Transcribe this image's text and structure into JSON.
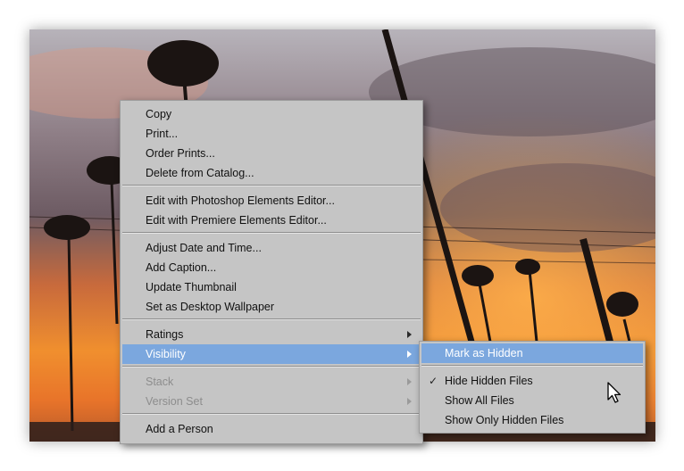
{
  "context_menu": {
    "items": [
      {
        "label": "Copy"
      },
      {
        "label": "Print..."
      },
      {
        "label": "Order Prints..."
      },
      {
        "label": "Delete from Catalog..."
      },
      {
        "label": "Edit with Photoshop Elements Editor..."
      },
      {
        "label": "Edit with Premiere Elements Editor..."
      },
      {
        "label": "Adjust Date and Time..."
      },
      {
        "label": "Add Caption..."
      },
      {
        "label": "Update Thumbnail"
      },
      {
        "label": "Set as Desktop Wallpaper"
      },
      {
        "label": "Ratings"
      },
      {
        "label": "Visibility"
      },
      {
        "label": "Stack"
      },
      {
        "label": "Version Set"
      },
      {
        "label": "Add a Person"
      }
    ]
  },
  "visibility_submenu": {
    "items": [
      {
        "label": "Mark as Hidden"
      },
      {
        "label": "Hide Hidden Files",
        "checked": true
      },
      {
        "label": "Show All Files"
      },
      {
        "label": "Show Only Hidden Files"
      }
    ],
    "check_glyph": "✓"
  },
  "colors": {
    "menu_background": "#c5c5c5",
    "highlight": "#7ba7de",
    "disabled_text": "#8d8d8d"
  },
  "icons": [
    "submenu-arrow-icon",
    "checkmark-icon",
    "mouse-pointer-icon"
  ]
}
